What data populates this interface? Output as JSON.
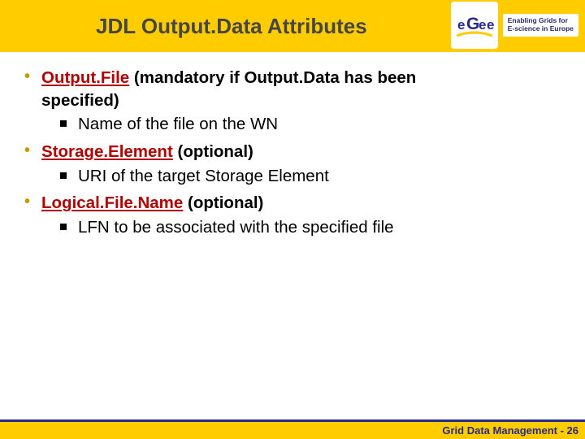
{
  "header": {
    "title": "JDL Output.Data Attributes",
    "logo_line1": "Enabling Grids for",
    "logo_line2": "E-science in Europe",
    "logo_letters": "eGee"
  },
  "items": [
    {
      "attr": "Output.File",
      "qualifier_prefix": " (mandatory if Output.Data has been",
      "qualifier_wrap": "specified)",
      "sub": "Name of the file on the WN"
    },
    {
      "attr": "Storage.Element",
      "qualifier_prefix": " (optional)",
      "qualifier_wrap": "",
      "sub": "URI of the target Storage Element"
    },
    {
      "attr": "Logical.File.Name",
      "qualifier_prefix": " (optional)",
      "qualifier_wrap": "",
      "sub": "LFN to be associated with the specified file"
    }
  ],
  "footer": {
    "text": "Grid Data Management - 26"
  }
}
